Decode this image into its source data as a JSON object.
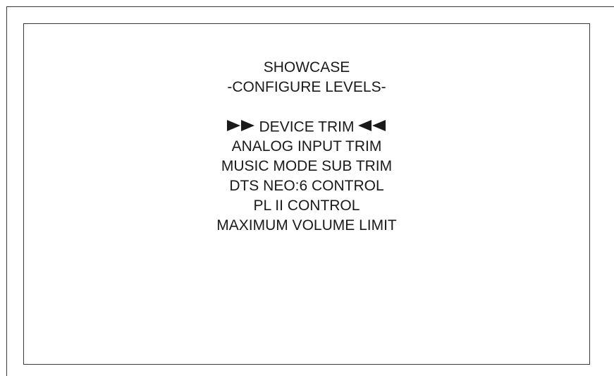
{
  "screen": {
    "title": "SHOWCASE",
    "subtitle": "-CONFIGURE LEVELS-",
    "menu_items": [
      {
        "label": "DEVICE TRIM",
        "selected": true
      },
      {
        "label": "ANALOG INPUT TRIM",
        "selected": false
      },
      {
        "label": "MUSIC MODE SUB TRIM",
        "selected": false
      },
      {
        "label": "DTS NEO:6 CONTROL",
        "selected": false
      },
      {
        "label": "PL II CONTROL",
        "selected": false
      },
      {
        "label": "MAXIMUM VOLUME LIMIT",
        "selected": false
      }
    ],
    "selection_indicator_left_icon": "double-right-arrow-icon",
    "selection_indicator_right_icon": "double-left-arrow-icon"
  }
}
